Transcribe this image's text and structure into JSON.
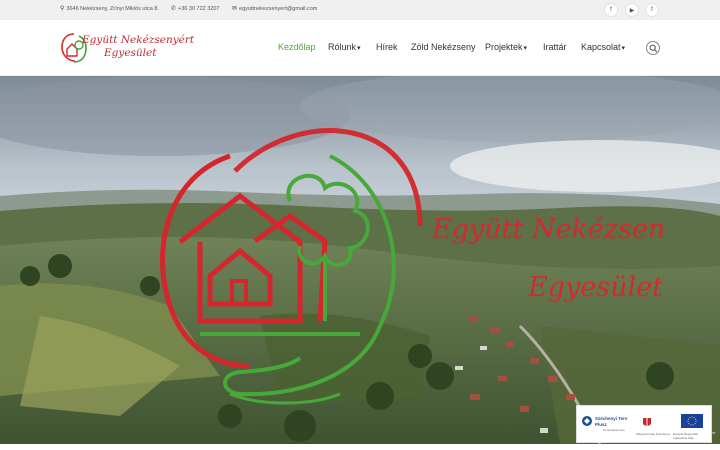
{
  "topbar": {
    "address": "3646 Nekézseny, Zrínyi Miklós utca 8.",
    "phone": "+36 30 722 3207",
    "email": "egyuttnekezsenyert@gmail.com",
    "social": [
      "f",
      "▶",
      "f"
    ]
  },
  "logo": {
    "line1": "Együtt Nekézsenyért",
    "line2": "Egyesület"
  },
  "nav": {
    "items": [
      {
        "label": "Kezdőlap",
        "dropdown": false,
        "active": true
      },
      {
        "label": "Rólunk",
        "dropdown": true,
        "active": false
      },
      {
        "label": "Hírek",
        "dropdown": false,
        "active": false
      },
      {
        "label": "Zöld Nekézseny",
        "dropdown": false,
        "active": false
      },
      {
        "label": "Projektek",
        "dropdown": true,
        "active": false
      },
      {
        "label": "Irattár",
        "dropdown": false,
        "active": false
      },
      {
        "label": "Kapcsolat",
        "dropdown": true,
        "active": false
      }
    ]
  },
  "hero": {
    "title_line1": "Együtt Nekézsen",
    "title_line2": "Egyesület"
  },
  "badge": {
    "line1": "Széchenyi Terv",
    "line2": "Plusz",
    "line3": "Az Európai Unió",
    "line4": "Magyarország Kormánya",
    "line5": "Európai Regionális Fejlesztési Alap"
  },
  "colors": {
    "accent_green": "#55a53b",
    "logo_red": "#d12a2f",
    "logo_green": "#3fa33b"
  }
}
